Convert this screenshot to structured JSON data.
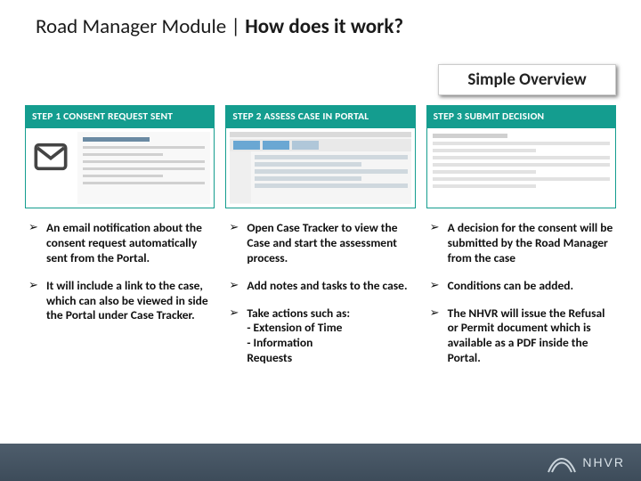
{
  "page_title_prefix": "Road Manager Module | ",
  "page_title_bold": "How does it work?",
  "subtitle": "Simple Overview",
  "steps": [
    {
      "header": "STEP 1  CONSENT REQUEST SENT",
      "bullets": [
        "An email notification about the consent request automatically sent from the Portal.",
        "It will include  a link to the case, which can also be viewed in side the Portal under Case Tracker."
      ]
    },
    {
      "header": "STEP 2  ASSESS CASE IN PORTAL",
      "bullets": [
        "Open Case Tracker to view the Case and start the assessment process.",
        "Add notes and tasks to the case.",
        "Take actions such as:\n- Extension of Time\n- Information\n   Requests"
      ]
    },
    {
      "header": "STEP 3  SUBMIT DECISION",
      "bullets": [
        "A decision for the consent will be submitted by the Road Manager from the case",
        "Conditions can be added.",
        "The NHVR will issue the Refusal or Permit document which is available as a PDF inside the Portal."
      ]
    }
  ],
  "logo_text": "NHVR"
}
